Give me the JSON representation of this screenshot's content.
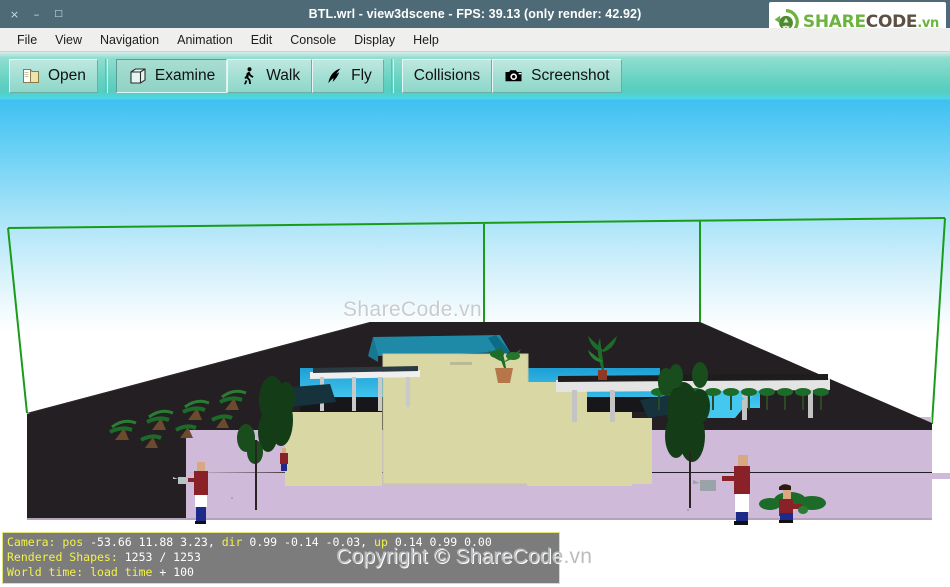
{
  "window": {
    "title": "BTL.wrl - view3dscene - FPS: 39.13 (only render: 42.92)",
    "controls": {
      "close": "×",
      "minimize": "–",
      "maximize": "□"
    }
  },
  "brand": {
    "share": "SHARE",
    "code": "CODE",
    "vn": ".vn",
    "green": "#6cb33f",
    "dark": "#5d5145"
  },
  "menubar": {
    "items": [
      {
        "label": "File"
      },
      {
        "label": "View"
      },
      {
        "label": "Navigation"
      },
      {
        "label": "Animation"
      },
      {
        "label": "Edit"
      },
      {
        "label": "Console"
      },
      {
        "label": "Display"
      },
      {
        "label": "Help"
      }
    ]
  },
  "toolbar": {
    "buttons": [
      {
        "label": "Open",
        "icon": "folder-icon",
        "pressed": false
      },
      {
        "label": "Examine",
        "icon": "cube-icon",
        "pressed": true
      },
      {
        "label": "Walk",
        "icon": "walk-icon",
        "pressed": false
      },
      {
        "label": "Fly",
        "icon": "bird-icon",
        "pressed": false
      },
      {
        "label": "Collisions",
        "icon": "none",
        "pressed": false
      },
      {
        "label": "Screenshot",
        "icon": "camera-icon",
        "pressed": false
      }
    ]
  },
  "viewport": {
    "watermark": "ShareCode.vn",
    "sky_top_color": "#3fc0f2",
    "sky_bottom_color": "#ffffff",
    "bbox_color": "#1a9c1a",
    "ground_color": "#241f22",
    "base_color": "#cfbad9",
    "building_color": "#d9d8a4",
    "roof_color": "#1f8aa8",
    "water_color": "#29b6e8"
  },
  "status": {
    "line1": {
      "label_camera": "Camera:",
      "label_pos": "pos",
      "value_pos": "-53.66 11.88 3.23,",
      "label_dir": "dir",
      "value_dir": "0.99 -0.14 -0.03,",
      "label_up": "up",
      "value_up": "0.14 0.99 0.00"
    },
    "line2": {
      "label": "Rendered Shapes:",
      "value": "1253 / 1253"
    },
    "line3": {
      "label": "World time:",
      "value_a": "load time",
      "value_b": "+ 100"
    }
  },
  "footer": {
    "copyright": "Copyright © ShareCode.vn"
  }
}
